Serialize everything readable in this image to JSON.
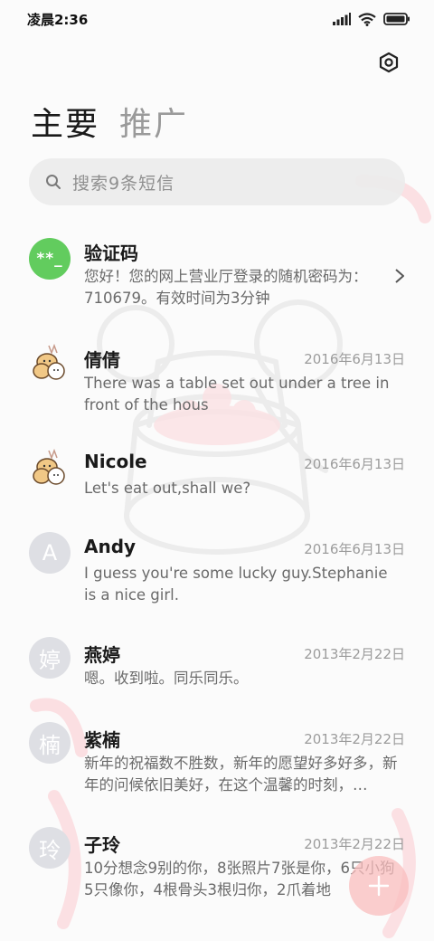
{
  "status_bar": {
    "time": "凌晨2:36",
    "icons": [
      "signal-icon",
      "wifi-icon",
      "battery-icon"
    ]
  },
  "settings": {
    "icon": "settings-hexagon-icon"
  },
  "tabs": [
    {
      "label": "主要",
      "active": true
    },
    {
      "label": "推广",
      "active": false
    }
  ],
  "search": {
    "placeholder": "搜索9条短信",
    "icon": "search-icon"
  },
  "conversations": [
    {
      "avatar": "**_",
      "avatar_type": "code",
      "name": "验证码",
      "date": "",
      "snippet": "您好！您的网上营业厅登录的随机密码为：710679。有效时间为3分钟",
      "chevron": true
    },
    {
      "avatar": "bear-cat-sticker",
      "avatar_type": "img",
      "name": "倩倩",
      "date": "2016年6月13日",
      "snippet": "There was a table set out under a tree in front of the hous"
    },
    {
      "avatar": "bear-cat-sticker",
      "avatar_type": "img",
      "name": "Nicole",
      "date": "2016年6月13日",
      "snippet": "Let's eat out,shall we?"
    },
    {
      "avatar": "A",
      "avatar_type": "letter",
      "name": "Andy",
      "date": "2016年6月13日",
      "snippet": "I guess you're some lucky guy.Stephanie is a nice girl."
    },
    {
      "avatar": "婷",
      "avatar_type": "letter",
      "name": "燕婷",
      "date": "2013年2月22日",
      "snippet": "嗯。收到啦。同乐同乐。"
    },
    {
      "avatar": "楠",
      "avatar_type": "letter",
      "name": "紫楠",
      "date": "2013年2月22日",
      "snippet": "新年的祝福数不胜数，新年的愿望好多好多，新年的问候依旧美好，在这个温馨的时刻，…"
    },
    {
      "avatar": "玲",
      "avatar_type": "letter",
      "name": "子玲",
      "date": "2013年2月22日",
      "snippet": "10分想念9别的你，8张照片7张是你，6只小狗5只像你，4根骨头3根归你，2爪着地"
    }
  ],
  "fab": {
    "icon": "plus-icon"
  },
  "colors": {
    "accent_green": "#62cc5e",
    "fab_pink": "#fabebe",
    "date_gray": "#9c9c9c"
  }
}
